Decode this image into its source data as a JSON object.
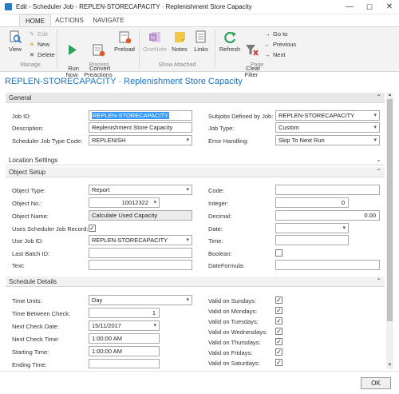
{
  "window": {
    "title": "Edit - Scheduler Job - REPLEN-STORECAPACITY · Replenishment Store Capacity",
    "minimize": "—",
    "maximize": "☐",
    "close": "✕"
  },
  "ribbon_tabs": [
    "HOME",
    "ACTIONS",
    "NAVIGATE"
  ],
  "ribbon": {
    "view": "View",
    "edit": "Edit",
    "new": "New",
    "delete": "Delete",
    "run_now": "Run\nNow",
    "convert": "Convert\nPreactions",
    "preload": "Preload",
    "onenote": "OneNote",
    "notes": "Notes",
    "links": "Links",
    "refresh": "Refresh",
    "clear_filter": "Clear\nFilter",
    "goto": "Go to",
    "previous": "Previous",
    "next": "Next",
    "groups": [
      "Manage",
      "Process",
      "Show Attached",
      "Page"
    ]
  },
  "header": "REPLEN-STORECAPACITY · Replenishment Store Capacity",
  "sections": {
    "general": "General",
    "location": "Location Settings",
    "object": "Object Setup",
    "schedule": "Schedule Details"
  },
  "general": {
    "job_id_label": "Job ID:",
    "job_id": "REPLEN-STORECAPACITY",
    "description_label": "Description:",
    "description": "Replenishment Store Capacity",
    "type_code_label": "Scheduler Job Type Code:",
    "type_code": "REPLENISH",
    "subjobs_label": "Subjobs Defined by Job:",
    "subjobs": "REPLEN-STORECAPACITY",
    "job_type_label": "Job Type:",
    "job_type": "Custom",
    "error_label": "Error Handling:",
    "error": "Skip To Next Run"
  },
  "object": {
    "object_type_label": "Object Type:",
    "object_type": "Report",
    "object_no_label": "Object No.:",
    "object_no": "10012322",
    "object_name_label": "Object Name:",
    "object_name": "Calculate Used Capacity",
    "uses_record_label": "Uses Scheduler Job Record:",
    "use_job_id_label": "Use Job ID:",
    "use_job_id": "REPLEN-STORECAPACITY",
    "last_batch_label": "Last Batch ID:",
    "last_batch": "",
    "text_label": "Text:",
    "text": "",
    "code_label": "Code:",
    "code": "",
    "integer_label": "Integer:",
    "integer": "0",
    "decimal_label": "Decimal:",
    "decimal": "0.00",
    "date_label": "Date:",
    "date": "",
    "time_label": "Time:",
    "time": "",
    "boolean_label": "Boolean:",
    "dateformula_label": "DateFormula:",
    "dateformula": ""
  },
  "schedule": {
    "time_units_label": "Time Units:",
    "time_units": "Day",
    "between_label": "Time Between Check:",
    "between": "1",
    "next_date_label": "Next Check Date:",
    "next_date": "15/11/2017",
    "next_time_label": "Next Check Time:",
    "next_time": "1:00:00 AM",
    "start_label": "Starting Time:",
    "start": "1:00:00 AM",
    "end_label": "Ending Time:",
    "end": "",
    "days": [
      "Valid on Sundays:",
      "Valid on Mondays:",
      "Valid on Tuesdays:",
      "Valid on Wednesdays:",
      "Valid on Thursdays:",
      "Valid on Fridays:",
      "Valid on Saturdays:"
    ]
  },
  "ok": "OK",
  "check": "✓",
  "chev": "▾",
  "collapse": "⌃",
  "expand": "⌄",
  "colors": {
    "accent": "#1e73be",
    "selection": "#3399ff",
    "ribbon_bg": "#f3f3f3"
  }
}
